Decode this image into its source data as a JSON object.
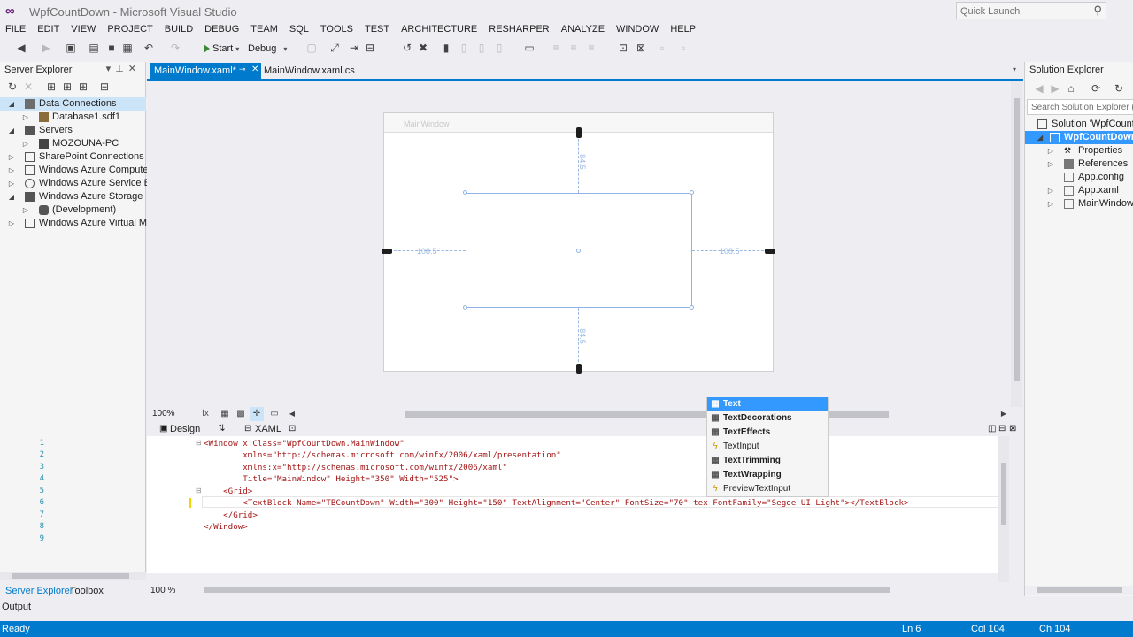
{
  "window": {
    "title": "WpfCountDown - Microsoft Visual Studio",
    "quick_launch_placeholder": "Quick Launch"
  },
  "menu": [
    "FILE",
    "EDIT",
    "VIEW",
    "PROJECT",
    "BUILD",
    "DEBUG",
    "TEAM",
    "SQL",
    "TOOLS",
    "TEST",
    "ARCHITECTURE",
    "RESHARPER",
    "ANALYZE",
    "WINDOW",
    "HELP"
  ],
  "toolbar": {
    "start_label": "Start",
    "config": "Debug"
  },
  "server_explorer": {
    "title": "Server Explorer",
    "items": [
      {
        "label": "Data Connections",
        "level": 0,
        "expanded": true,
        "selected": true,
        "icon": "data-connections-icon"
      },
      {
        "label": "Database1.sdf1",
        "level": 1,
        "expanded": false,
        "icon": "database-icon"
      },
      {
        "label": "Servers",
        "level": 0,
        "expanded": true,
        "icon": "servers-icon"
      },
      {
        "label": "MOZOUNA-PC",
        "level": 1,
        "expanded": false,
        "icon": "server-icon"
      },
      {
        "label": "SharePoint Connections",
        "level": 0,
        "expanded": false,
        "icon": "sharepoint-icon"
      },
      {
        "label": "Windows Azure Compute",
        "level": 0,
        "expanded": false,
        "icon": "azure-compute-icon"
      },
      {
        "label": "Windows Azure Service Bus",
        "level": 0,
        "expanded": false,
        "icon": "azure-servicebus-icon"
      },
      {
        "label": "Windows Azure Storage",
        "level": 0,
        "expanded": true,
        "icon": "azure-storage-icon"
      },
      {
        "label": "(Development)",
        "level": 1,
        "expanded": false,
        "icon": "storage-account-icon"
      },
      {
        "label": "Windows Azure Virtual Machines",
        "level": 0,
        "expanded": false,
        "icon": "azure-vm-icon"
      }
    ],
    "bottom_tabs": [
      "Server Explorer",
      "Toolbox"
    ]
  },
  "doc_tabs": {
    "active": "MainWindow.xaml*",
    "other": "MainWindow.xaml.cs"
  },
  "designer": {
    "window_title": "MainWindow",
    "margin_top": "84.5",
    "margin_bottom": "84.5",
    "margin_left": "108.5",
    "margin_right": "108.5",
    "zoom": "100%"
  },
  "split_tabs": {
    "design": "Design",
    "xaml": "XAML"
  },
  "code": {
    "line_numbers": [
      "1",
      "2",
      "3",
      "4",
      "5",
      "6",
      "7",
      "8",
      "9"
    ],
    "lines": [
      "<Window x:Class=\"WpfCountDown.MainWindow\"",
      "        xmlns=\"http://schemas.microsoft.com/winfx/2006/xaml/presentation\"",
      "        xmlns:x=\"http://schemas.microsoft.com/winfx/2006/xaml\"",
      "        Title=\"MainWindow\" Height=\"350\" Width=\"525\">",
      "    <Grid>",
      "        <TextBlock Name=\"TBCountDown\" Width=\"300\" Height=\"150\" TextAlignment=\"Center\" FontSize=\"70\" tex FontFamily=\"Segoe UI Light\"></TextBlock>",
      "    </Grid>",
      "</Window>",
      ""
    ],
    "zoom": "100 %"
  },
  "intellisense": [
    {
      "label": "Text",
      "kind": "property",
      "bold": true,
      "selected": true
    },
    {
      "label": "TextDecorations",
      "kind": "property",
      "bold": true
    },
    {
      "label": "TextEffects",
      "kind": "property",
      "bold": true
    },
    {
      "label": "TextInput",
      "kind": "event",
      "bold": false
    },
    {
      "label": "TextTrimming",
      "kind": "property",
      "bold": true
    },
    {
      "label": "TextWrapping",
      "kind": "property",
      "bold": true
    },
    {
      "label": "PreviewTextInput",
      "kind": "event",
      "bold": false
    }
  ],
  "solution_explorer": {
    "title": "Solution Explorer",
    "search_placeholder": "Search Solution Explorer (C",
    "items": [
      {
        "label": "Solution 'WpfCountDown'",
        "level": 0,
        "icon": "solution-icon"
      },
      {
        "label": "WpfCountDown",
        "level": 1,
        "selected": true,
        "bold": true,
        "icon": "csharp-project-icon"
      },
      {
        "label": "Properties",
        "level": 2,
        "icon": "wrench-icon"
      },
      {
        "label": "References",
        "level": 2,
        "icon": "references-icon"
      },
      {
        "label": "App.config",
        "level": 2,
        "icon": "config-file-icon"
      },
      {
        "label": "App.xaml",
        "level": 2,
        "icon": "xaml-file-icon"
      },
      {
        "label": "MainWindow.xaml",
        "level": 2,
        "icon": "xaml-file-icon"
      }
    ]
  },
  "output_tab": "Output",
  "status": {
    "ready": "Ready",
    "ln": "Ln 6",
    "col": "Col 104",
    "ch": "Ch 104"
  },
  "colors": {
    "accent": "#007acc",
    "selection": "#3399ff",
    "brand": "#68217a"
  }
}
